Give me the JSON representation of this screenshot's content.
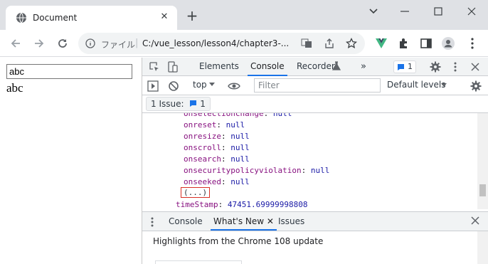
{
  "tab": {
    "title": "Document",
    "close_glyph": "✕",
    "newtab_glyph": "+"
  },
  "omnibox": {
    "scheme": "ファイル",
    "separator": "|",
    "url": "C:/vue_lesson/lesson4/chapter3-..."
  },
  "page": {
    "input_value": "abc",
    "text": "abc"
  },
  "devtools": {
    "tabs": [
      "Elements",
      "Console",
      "Recorder",
      "»"
    ],
    "active_tab": "Console",
    "issues_badge_count": "1",
    "context": "top",
    "filter_placeholder": "Filter",
    "levels": "Default levels",
    "issues_button": "1 Issue:",
    "issues_count": "1",
    "console_lines": [
      {
        "key": "onreset",
        "value": "null"
      },
      {
        "key": "onresize",
        "value": "null"
      },
      {
        "key": "onscroll",
        "value": "null"
      },
      {
        "key": "onsearch",
        "value": "null"
      },
      {
        "key": "onsecuritypolicyviolation",
        "value": "null"
      },
      {
        "key": "onseeked",
        "value": "null"
      }
    ],
    "ellipsis": "(...)",
    "timestamp_key": "timeStamp",
    "timestamp_value": "47451.69999998808",
    "drawer_tabs": [
      "Console",
      "What's New",
      "Issues"
    ],
    "drawer_active": "What's New",
    "drawer_headline": "Highlights from the Chrome 108 update"
  },
  "colors": {
    "accent": "#1a73e8",
    "vue_green": "#41b883",
    "highlight_box": "#d93025"
  }
}
